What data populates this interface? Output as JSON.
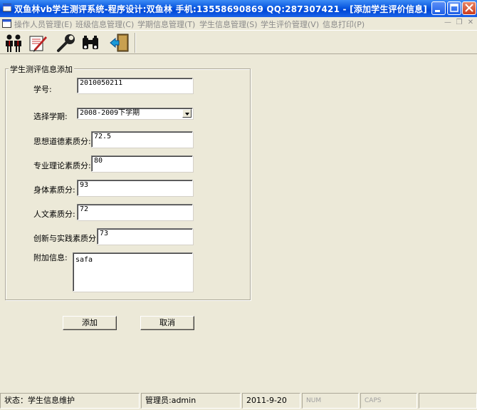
{
  "window": {
    "title": "双鱼林vb学生测评系统-程序设计:双鱼林 手机:13558690869 QQ:287307421 - [添加学生评价信息]"
  },
  "menu": {
    "items": [
      {
        "label": "操作人员管理(E)"
      },
      {
        "label": "班级信息管理(C)"
      },
      {
        "label": "学期信息管理(T)"
      },
      {
        "label": "学生信息管理(S)"
      },
      {
        "label": "学生评价管理(V)"
      },
      {
        "label": "信息打印(P)"
      }
    ]
  },
  "toolbar": {
    "icons": [
      "users-icon",
      "edit-note-icon",
      "wrench-icon",
      "binoculars-icon",
      "exit-door-icon"
    ]
  },
  "form": {
    "group_title": "学生测评信息添加",
    "student_id": {
      "label": "学号:",
      "value": "2010050211"
    },
    "semester": {
      "label": "选择学期:",
      "value": "2008-2009下学期"
    },
    "moral_score": {
      "label": "思想道德素质分:",
      "value": "72.5"
    },
    "professional_score": {
      "label": "专业理论素质分:",
      "value": "80"
    },
    "physical_score": {
      "label": "身体素质分:",
      "value": "93"
    },
    "humanities_score": {
      "label": "人文素质分:",
      "value": "72"
    },
    "innovation_score": {
      "label": "创新与实践素质分:",
      "value": "73"
    },
    "extra_info": {
      "label": "附加信息:",
      "value": "safa"
    }
  },
  "buttons": {
    "add": "添加",
    "cancel": "取消"
  },
  "statusbar": {
    "status": "状态：学生信息维护",
    "admin": "管理员:admin",
    "date": "2011-9-20",
    "num": "NUM",
    "caps": "CAPS"
  },
  "colors": {
    "titlebar": "#0a58e0",
    "window_bg": "#ece9d8",
    "close_button": "#cc3c1c"
  }
}
